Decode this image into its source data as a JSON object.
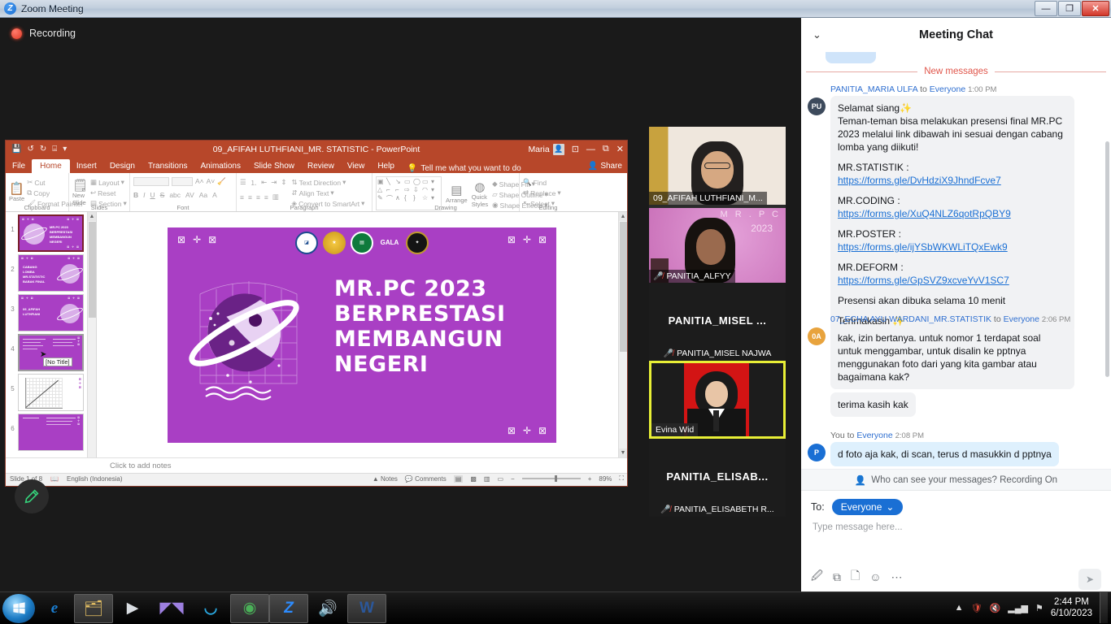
{
  "window": {
    "title": "Zoom Meeting",
    "logo_letter": "Z",
    "controls": {
      "minimize": "—",
      "maximize": "❐",
      "close": "✕"
    }
  },
  "recording": {
    "label": "Recording"
  },
  "powerpoint": {
    "file_title": "09_AFIFAH LUTHFIANI_MR. STATISTIC  -  PowerPoint",
    "quick_access": [
      "save-icon",
      "undo-icon",
      "redo-icon",
      "present-icon",
      "customize-icon"
    ],
    "user_name": "Maria",
    "win_controls": {
      "minimize": "—",
      "restore": "⧉",
      "close": "✕",
      "ribbon": "⊡"
    },
    "tabs": [
      "File",
      "Home",
      "Insert",
      "Design",
      "Transitions",
      "Animations",
      "Slide Show",
      "Review",
      "View",
      "Help"
    ],
    "active_tab": "Home",
    "tell_me": "Tell me what you want to do",
    "share_label": "Share",
    "ribbon_groups": [
      {
        "label": "Clipboard",
        "items": [
          "Paste",
          "Cut",
          "Copy",
          "Format Painter"
        ]
      },
      {
        "label": "Slides",
        "items": [
          "New Slide",
          "Layout",
          "Reset",
          "Section"
        ]
      },
      {
        "label": "Font",
        "items": [
          "B",
          "I",
          "U",
          "S",
          "abc"
        ]
      },
      {
        "label": "Paragraph",
        "items": [
          "Text Direction",
          "Align Text",
          "Convert to SmartArt"
        ]
      },
      {
        "label": "Drawing",
        "items": [
          "Arrange",
          "Quick Styles",
          "Shape Fill",
          "Shape Outline",
          "Shape Effects"
        ]
      },
      {
        "label": "Editing",
        "items": [
          "Find",
          "Replace",
          "Select"
        ]
      }
    ],
    "slide_title_lines": [
      "MR.PC 2023",
      "BERPRESTASI",
      "MEMBANGUN",
      "NEGERI"
    ],
    "thumbnails": [
      {
        "number": "1",
        "lines": [
          "MR.PC 2023",
          "BERPRESTASI",
          "MEMBANGUN",
          "NEGERI"
        ],
        "selected": true
      },
      {
        "number": "2",
        "lines": [
          "CABANG",
          "LOMBA",
          "MR.STATISTIC",
          "BABAK FINAL"
        ],
        "selected": false
      },
      {
        "number": "3",
        "lines": [
          "09_AFIFAH",
          "LUTHFIANI"
        ],
        "selected": false
      },
      {
        "number": "4",
        "lines": [],
        "selected": false,
        "tooltip": "[No Title]"
      },
      {
        "number": "5",
        "lines": [],
        "selected": false
      },
      {
        "number": "6",
        "lines": [],
        "selected": false
      }
    ],
    "notes_placeholder": "Click to add notes",
    "status": {
      "slide_counter": "Slide 1 of 8",
      "language": "English (Indonesia)",
      "notes_label": "Notes",
      "comments_label": "Comments",
      "zoom_level": "89%"
    }
  },
  "video_tiles": [
    {
      "name": "09_AFIFAH LUTHFIANI_M...",
      "muted": false,
      "has_video": true,
      "active": false
    },
    {
      "name": "PANITIA_ALFYY",
      "muted": true,
      "has_video": true,
      "active": false
    },
    {
      "name": "PANITIA_MISEL NAJWA",
      "center_initials": "PANITIA_MISEL ...",
      "muted": true,
      "has_video": false,
      "active": false
    },
    {
      "name": "Evina Wid",
      "muted": false,
      "has_video": true,
      "active": true
    },
    {
      "name": "PANITIA_ELISABETH R...",
      "center_initials": "PANITIA_ELISAB...",
      "muted": true,
      "has_video": false,
      "active": false
    }
  ],
  "chat": {
    "title": "Meeting Chat",
    "new_messages_label": "New messages",
    "messages": [
      {
        "avatar": "PU",
        "avatar_color": "#3d4a5c",
        "sender": "PANITIA_MARIA ULFA",
        "to_word": "to",
        "target": "Everyone",
        "time": "1:00 PM",
        "self": false,
        "lines": [
          {
            "type": "text",
            "text": "Selamat siang✨"
          },
          {
            "type": "text",
            "text": "Teman-teman bisa melakukan presensi final MR.PC 2023 melalui link dibawah ini sesuai dengan cabang lomba yang diikuti!"
          },
          {
            "type": "blank"
          },
          {
            "type": "link",
            "prefix": "MR.STATISTIK : ",
            "url": "https://forms.gle/DvHdziX9JhndFcve7"
          },
          {
            "type": "blank"
          },
          {
            "type": "link",
            "prefix": "MR.CODING : ",
            "url": "https://forms.gle/XuQ4NLZ6qotRpQBY9"
          },
          {
            "type": "blank"
          },
          {
            "type": "link",
            "prefix": "MR.POSTER : ",
            "url": "https://forms.gle/ijYSbWKWLiTQxEwk9"
          },
          {
            "type": "blank"
          },
          {
            "type": "link",
            "prefix": "MR.DEFORM : ",
            "url": "https://forms.gle/GpSVZ9xcveYvV1SC7"
          },
          {
            "type": "blank"
          },
          {
            "type": "text",
            "text": "Presensi akan dibuka selama 10 menit"
          },
          {
            "type": "blank"
          },
          {
            "type": "text",
            "text": "Terimakasih ✨"
          }
        ]
      },
      {
        "avatar": "0A",
        "avatar_color": "#e8a33d",
        "sender": "07_ECHA AYU WARDANI_MR.STATISTIK",
        "to_word": "to",
        "target": "Everyone",
        "time": "2:06 PM",
        "self": false,
        "lines": [
          {
            "type": "text",
            "text": "kak, izin bertanya. untuk nomor 1 terdapat soal untuk menggambar, untuk disalin ke pptnya menggunakan foto dari yang kita gambar atau bagaimana kak?"
          }
        ],
        "followup": "terima kasih kak"
      },
      {
        "avatar": "P",
        "avatar_color": "#1a6fd4",
        "sender": "You",
        "to_word": "to",
        "target": "Everyone",
        "time": "2:08 PM",
        "self": true,
        "lines": [
          {
            "type": "text",
            "text": "d foto aja kak, di scan, terus d masukkin d pptnya"
          }
        ]
      }
    ],
    "reactions": [
      "reply-icon",
      "emoji-icon",
      "more-icon"
    ],
    "privacy_notice": "Who can see your messages? Recording On",
    "to_label": "To:",
    "to_value": "Everyone",
    "input_placeholder": "Type message here...",
    "tool_icons": [
      "format-icon",
      "screenshot-icon",
      "file-icon",
      "emoji-icon",
      "more-icon"
    ],
    "send_label": "send-icon"
  },
  "taskbar": {
    "start": "windows-start-orb",
    "items": [
      {
        "name": "internet-explorer",
        "glyph": "e",
        "open": false
      },
      {
        "name": "file-explorer",
        "glyph": "🗂",
        "open": true
      },
      {
        "name": "media-player",
        "glyph": "▶",
        "open": false
      },
      {
        "name": "movie-maker",
        "glyph": "◤◥",
        "open": false
      },
      {
        "name": "microsoft-edge",
        "glyph": "e",
        "open": false
      },
      {
        "name": "google-chrome",
        "glyph": "◉",
        "open": true
      },
      {
        "name": "zoom",
        "glyph": "Z",
        "open": true
      },
      {
        "name": "volume-app",
        "glyph": "🔊",
        "open": false
      },
      {
        "name": "microsoft-word",
        "glyph": "W",
        "open": true
      }
    ],
    "tray": [
      "show-hidden-icons",
      "antivirus-icon",
      "volume-muted-icon",
      "network-icon",
      "action-center-icon"
    ],
    "clock_time": "2:44 PM",
    "clock_date": "6/10/2023"
  }
}
